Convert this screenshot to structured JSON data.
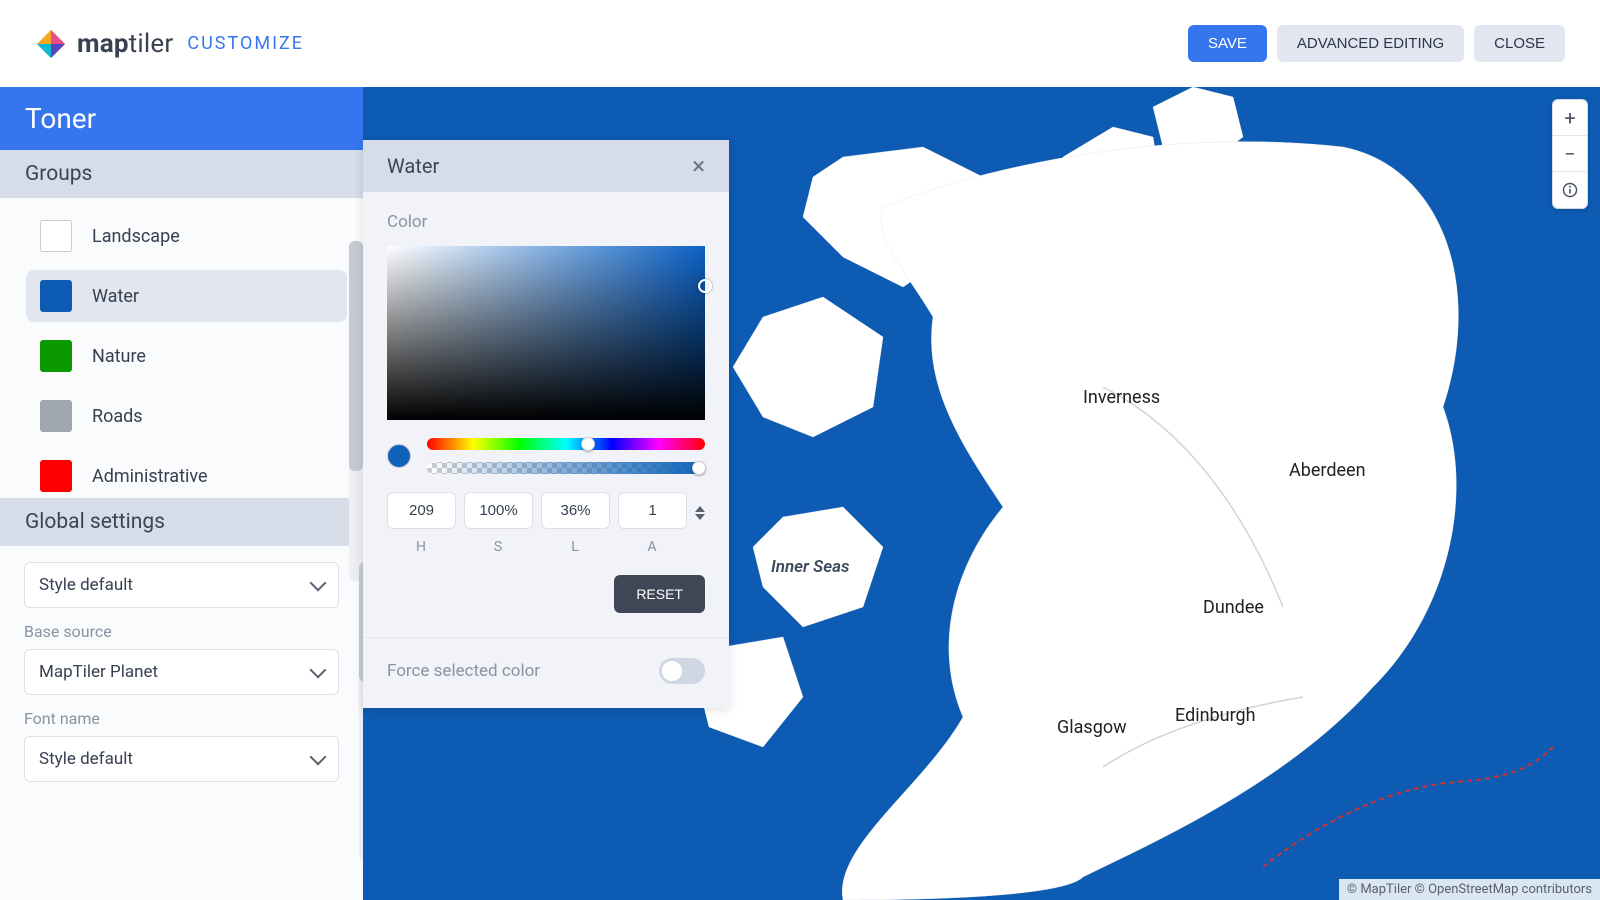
{
  "brand": {
    "main": "maptiler",
    "sub": "CUSTOMIZE"
  },
  "top_actions": {
    "save": "SAVE",
    "advanced": "ADVANCED EDITING",
    "close": "CLOSE"
  },
  "style_name": "Toner",
  "groups_header": "Groups",
  "groups": [
    {
      "label": "Landscape",
      "color": "#ffffff"
    },
    {
      "label": "Water",
      "color": "#0d5bb3",
      "selected": true
    },
    {
      "label": "Nature",
      "color": "#0a9a00"
    },
    {
      "label": "Roads",
      "color": "#a0a6ae"
    },
    {
      "label": "Administrative",
      "color": "#ff0000"
    }
  ],
  "global_header": "Global settings",
  "global": {
    "style_default": "Style default",
    "base_source_label": "Base source",
    "base_source_value": "MapTiler Planet",
    "font_label": "Font name",
    "font_value": "Style default"
  },
  "panel": {
    "title": "Water",
    "color_label": "Color",
    "hsla": {
      "h": "209",
      "s": "100%",
      "l": "36%",
      "a": "1",
      "lblH": "H",
      "lblS": "S",
      "lblL": "L",
      "lblA": "A"
    },
    "reset": "RESET",
    "force_label": "Force selected color"
  },
  "map_labels": {
    "inverness": "Inverness",
    "aberdeen": "Aberdeen",
    "dundee": "Dundee",
    "edinburgh": "Edinburgh",
    "glasgow": "Glasgow",
    "inner_seas": "Inner Seas"
  },
  "attrib": "© MapTiler © OpenStreetMap contributors"
}
